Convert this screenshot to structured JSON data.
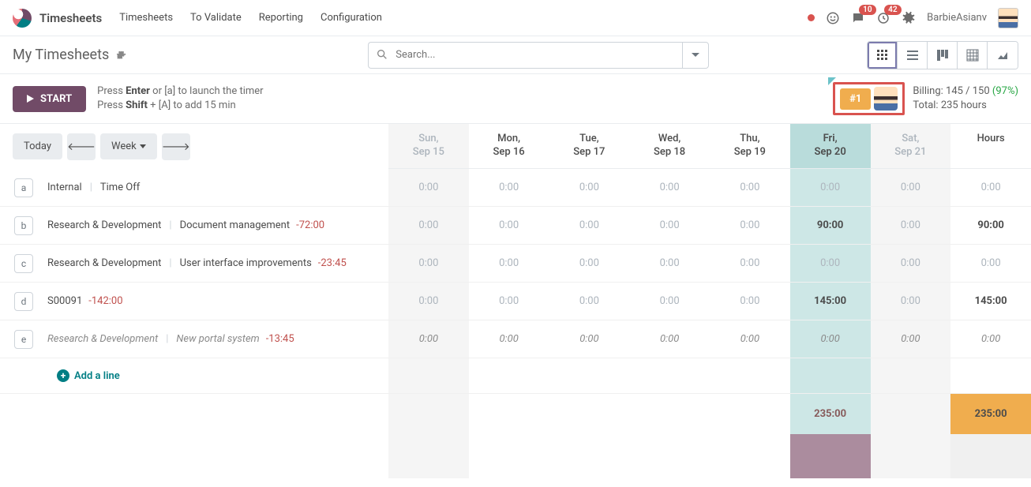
{
  "header": {
    "app": "Timesheets",
    "nav": [
      "Timesheets",
      "To Validate",
      "Reporting",
      "Configuration"
    ],
    "msg_badge": "10",
    "act_badge": "42",
    "user": "BarbieAsianv"
  },
  "page": {
    "title": "My Timesheets",
    "search_placeholder": "Search..."
  },
  "actions": {
    "start": "START",
    "hint1a": "Press ",
    "hint1b": "Enter",
    "hint1c": " or [a] to launch the timer",
    "hint2a": "Press ",
    "hint2b": "Shift",
    "hint2c": " + [A] to add 15 min",
    "rank": "#1",
    "billing_label": "Billing: ",
    "billing_val": "145 / 150 ",
    "billing_pct": "(97%)",
    "total_label": "Total: ",
    "total_val": "235 hours"
  },
  "nav2": {
    "today": "Today",
    "scale": "Week"
  },
  "days": {
    "d0a": "Sun,",
    "d0b": "Sep 15",
    "d1a": "Mon,",
    "d1b": "Sep 16",
    "d2a": "Tue,",
    "d2b": "Sep 17",
    "d3a": "Wed,",
    "d3b": "Sep 18",
    "d4a": "Thu,",
    "d4b": "Sep 19",
    "d5a": "Fri,",
    "d5b": "Sep 20",
    "d6a": "Sat,",
    "d6b": "Sep 21",
    "hours": "Hours"
  },
  "rows": [
    {
      "k": "a",
      "p": "Internal",
      "t": "Time Off",
      "neg": "",
      "d": [
        "0:00",
        "0:00",
        "0:00",
        "0:00",
        "0:00",
        "0:00",
        "0:00"
      ],
      "tot": "0:00",
      "bold": false,
      "ital": false
    },
    {
      "k": "b",
      "p": "Research & Development",
      "t": "Document management",
      "neg": "-72:00",
      "d": [
        "0:00",
        "0:00",
        "0:00",
        "0:00",
        "0:00",
        "90:00",
        "0:00"
      ],
      "tot": "90:00",
      "bold": true,
      "ital": false
    },
    {
      "k": "c",
      "p": "Research & Development",
      "t": "User interface improvements",
      "neg": "-23:45",
      "d": [
        "0:00",
        "0:00",
        "0:00",
        "0:00",
        "0:00",
        "0:00",
        "0:00"
      ],
      "tot": "0:00",
      "bold": false,
      "ital": false
    },
    {
      "k": "d",
      "p": "S00091",
      "t": "",
      "neg": "-142:00",
      "d": [
        "0:00",
        "0:00",
        "0:00",
        "0:00",
        "0:00",
        "145:00",
        "0:00"
      ],
      "tot": "145:00",
      "bold": true,
      "ital": false
    },
    {
      "k": "e",
      "p": "Research & Development",
      "t": "New portal system",
      "neg": "-13:45",
      "d": [
        "0:00",
        "0:00",
        "0:00",
        "0:00",
        "0:00",
        "0:00",
        "0:00"
      ],
      "tot": "0:00",
      "bold": false,
      "ital": true
    }
  ],
  "addline": "Add a line",
  "totals": {
    "fri": "235:00",
    "hours": "235:00"
  }
}
